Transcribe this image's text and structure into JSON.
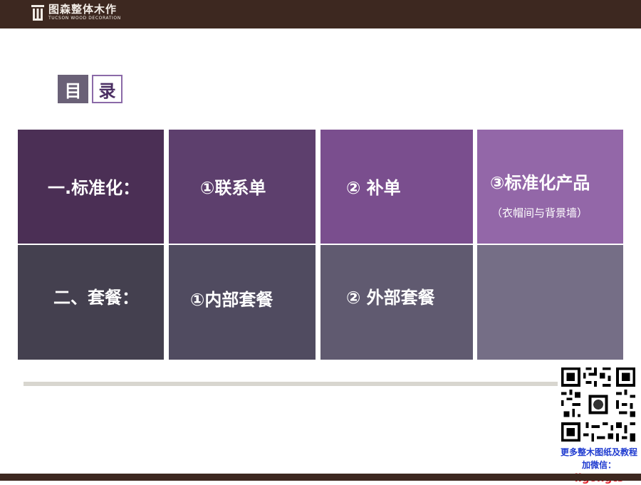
{
  "header": {
    "brand_cn": "图森整体木作",
    "brand_en": "TUCSON WOOD DECORATION"
  },
  "toc": {
    "char1": "目",
    "char2": "录"
  },
  "rows": [
    {
      "title": "一.标准化：",
      "items": [
        {
          "label": "①联系单"
        },
        {
          "label": "② 补单"
        },
        {
          "label": "③标准化产品",
          "sub": "（衣帽间与背景墙）"
        }
      ]
    },
    {
      "title": "二、套餐：",
      "items": [
        {
          "label": "①内部套餐"
        },
        {
          "label": "② 外部套餐"
        },
        {
          "label": ""
        }
      ]
    }
  ],
  "watermark": {
    "line1": "更多整木图纸及教程",
    "line2_prefix": "加微信：",
    "line2_id": "ligongts"
  },
  "colors": {
    "header_bg": "#3d2820",
    "row1": [
      "#4b2f55",
      "#5d3f6d",
      "#7a4e8e",
      "#9367a8"
    ],
    "row2": [
      "#44404f",
      "#504b60",
      "#605a70",
      "#756e86"
    ],
    "qr_caption_blue": "#1f3bd0",
    "qr_caption_red": "#e2202a"
  },
  "icons": [
    "logo-mark-icon",
    "qr-code-icon"
  ]
}
